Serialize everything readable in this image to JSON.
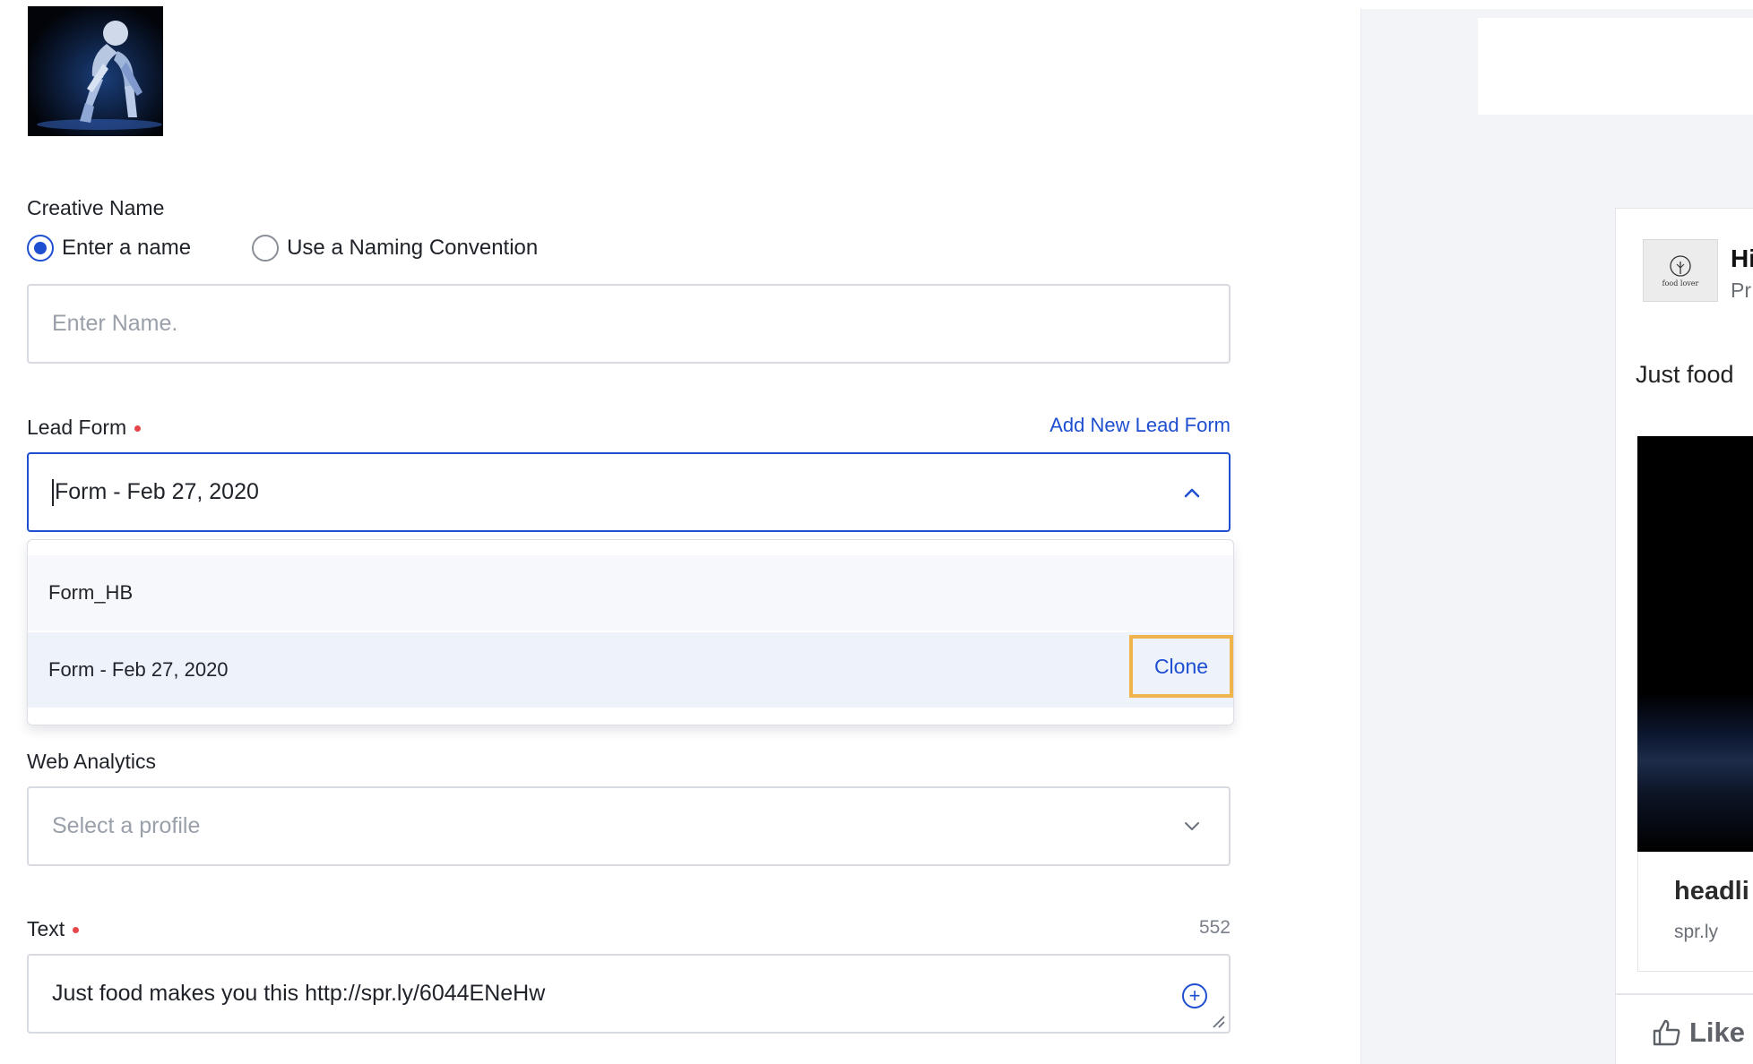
{
  "creative_name": {
    "label": "Creative Name",
    "options": [
      {
        "label": "Enter a name",
        "checked": true
      },
      {
        "label": "Use a Naming Convention",
        "checked": false
      }
    ],
    "input_placeholder": "Enter  Name."
  },
  "lead_form": {
    "label": "Lead Form",
    "add_link": "Add New Lead Form",
    "selected_value": "Form - Feb 27, 2020",
    "options": [
      {
        "label": "Form_HB"
      },
      {
        "label": "Form - Feb 27, 2020",
        "action": "Clone"
      }
    ]
  },
  "web_analytics": {
    "label": "Web Analytics",
    "placeholder": "Select a profile"
  },
  "text_field": {
    "label": "Text",
    "char_count": "552",
    "value": "Just food makes you this http://spr.ly/6044ENeHw"
  },
  "preview": {
    "page_name": "Hi",
    "page_sub": "Pr",
    "post_text": "Just food",
    "avatar_text": "food lover",
    "headline": "headli",
    "domain": "spr.ly",
    "like_label": "Like"
  },
  "colors": {
    "accent": "#1f4fd1",
    "required": "#e6454a",
    "highlight": "#f0b54a"
  }
}
